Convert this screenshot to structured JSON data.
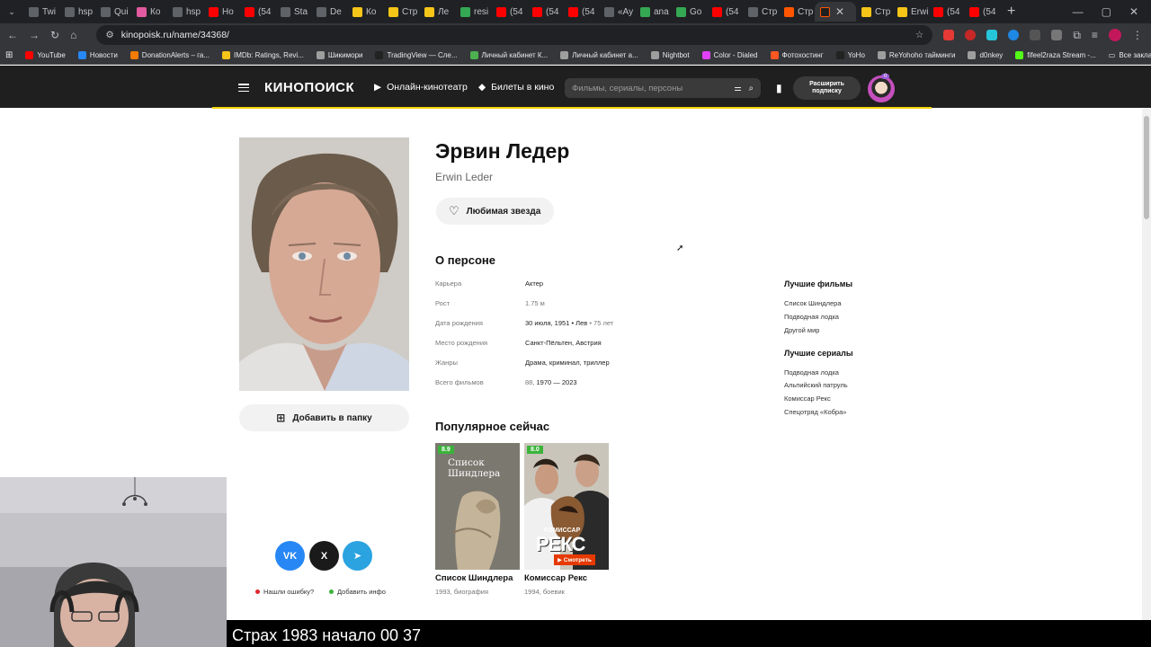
{
  "browser": {
    "tabs": [
      {
        "label": "Twi",
        "color": "#5f6368"
      },
      {
        "label": "hsp",
        "color": "#5f6368"
      },
      {
        "label": "Qui",
        "color": "#5f6368"
      },
      {
        "label": "Ко",
        "color": "#e35aa0"
      },
      {
        "label": "hsp",
        "color": "#5f6368"
      },
      {
        "label": "Ho",
        "color": "#ff0000"
      },
      {
        "label": "(54",
        "color": "#ff0000"
      },
      {
        "label": "Sta",
        "color": "#5f6368"
      },
      {
        "label": "De",
        "color": "#5f6368"
      },
      {
        "label": "Ко",
        "color": "#f5c518"
      },
      {
        "label": "Стр",
        "color": "#f5c518"
      },
      {
        "label": "Ле",
        "color": "#f5c518"
      },
      {
        "label": "resi",
        "color": "#34a853"
      },
      {
        "label": "(54",
        "color": "#ff0000"
      },
      {
        "label": "(54",
        "color": "#ff0000"
      },
      {
        "label": "(54",
        "color": "#ff0000"
      },
      {
        "label": "«Ау",
        "color": "#5f6368"
      },
      {
        "label": "ana",
        "color": "#34a853"
      },
      {
        "label": "Go",
        "color": "#34a853"
      },
      {
        "label": "(54",
        "color": "#ff0000"
      },
      {
        "label": "Стр",
        "color": "#5f6368"
      },
      {
        "label": "Стр",
        "color": "#ff5500"
      }
    ],
    "active_tab_label": "",
    "tabs_after": [
      {
        "label": "Стр",
        "color": "#f5c518"
      },
      {
        "label": "Erwi",
        "color": "#f5c518"
      },
      {
        "label": "(54",
        "color": "#ff0000"
      },
      {
        "label": "(54",
        "color": "#ff0000"
      }
    ],
    "url": "kinopoisk.ru/name/34368/",
    "bookmarks": [
      {
        "label": "YouTube",
        "color": "#ff0000"
      },
      {
        "label": "Новости",
        "color": "#2787f5"
      },
      {
        "label": "DonationAlerts – га...",
        "color": "#f57c00"
      },
      {
        "label": "IMDb: Ratings, Revi...",
        "color": "#f5c518"
      },
      {
        "label": "Шикимори",
        "color": "#9e9e9e"
      },
      {
        "label": "TradingView — Сле...",
        "color": "#222222"
      },
      {
        "label": "Личный кабинет К...",
        "color": "#4caf50"
      },
      {
        "label": "Личный кабинет а...",
        "color": "#9e9e9e"
      },
      {
        "label": "Nightbot",
        "color": "#9e9e9e"
      },
      {
        "label": "Color - Dialed",
        "color": "#e040fb"
      },
      {
        "label": "Фотохостинг",
        "color": "#ff5722"
      },
      {
        "label": "YoHo",
        "color": "#222222"
      },
      {
        "label": "ReYohoho тайминги",
        "color": "#9e9e9e"
      },
      {
        "label": "d0nkey",
        "color": "#9e9e9e"
      },
      {
        "label": "fifeel2raza Stream -...",
        "color": "#53fc18"
      }
    ],
    "all_bookmarks": "Все закладки"
  },
  "site": {
    "logo": "КИНОПОИСК",
    "nav": {
      "online": "Онлайн-кинотеатр",
      "tickets": "Билеты в кино"
    },
    "search_placeholder": "Фильмы, сериалы, персоны",
    "subscribe_line1": "Расширить",
    "subscribe_line2": "подписку",
    "avatar_badge": "0"
  },
  "person": {
    "name": "Эрвин Ледер",
    "original_name": "Erwin Leder",
    "favorite_button": "Любимая звезда",
    "add_to_folder": "Добавить в папку",
    "about_heading": "О персоне",
    "info": [
      {
        "label": "Карьера",
        "value": "Актер",
        "extra": ""
      },
      {
        "label": "Рост",
        "value": "",
        "extra": "1.75 м"
      },
      {
        "label": "Дата рождения",
        "value": "30 июля, 1951 • Лев",
        "extra": " • 75 лет"
      },
      {
        "label": "Место рождения",
        "value": "Санкт-Пёльтен, Австрия",
        "extra": ""
      },
      {
        "label": "Жанры",
        "value": "Драма, криминал, триллер",
        "extra": ""
      },
      {
        "label": "Всего фильмов",
        "value": "",
        "extra": "88, ",
        "value2": "1970 — 2023"
      }
    ],
    "best_films_heading": "Лучшие фильмы",
    "best_films": [
      "Список Шиндлера",
      "Подводная лодка",
      "Другой мир"
    ],
    "best_series_heading": "Лучшие сериалы",
    "best_series": [
      "Подводная лодка",
      "Альпийский патруль",
      "Комиссар Рекс",
      "Спецотряд «Кобра»"
    ],
    "popular_heading": "Популярное сейчас",
    "popular": [
      {
        "title": "Список Шиндлера",
        "sub": "1993, биография",
        "rating": "8.9",
        "poster_text": "Список Шиндлера"
      },
      {
        "title": "Комиссар Рекс",
        "sub": "1994, боевик",
        "rating": "8.0",
        "poster_top": "КОМИССАР",
        "poster_main": "РЕКС",
        "poster_watch": "▶ Смотреть"
      }
    ],
    "report_error": "Нашли ошибку?",
    "add_info": "Добавить инфо"
  },
  "colors": {
    "accent_yellow": "#f2d400",
    "rating_green": "#3bb33b",
    "vk": "#2787f5",
    "x": "#1a1a1a",
    "telegram": "#2aa3e0"
  },
  "video_caption": "Страх 1983 начало 00 37"
}
